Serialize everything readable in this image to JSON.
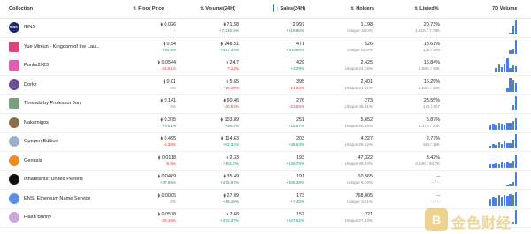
{
  "header": {
    "collection": "Collection",
    "floor": "Floor Price",
    "volume": "Volume(24H)",
    "sales": "Sales(24H)",
    "holders": "Holders",
    "listed": "Listed%",
    "volume7d": "7D Volume"
  },
  "eth_symbol": "⧫",
  "rows": [
    {
      "name": "fENS",
      "floor": "0.026",
      "floor_ch": "--",
      "floor_dir": "none",
      "vol": "71.58",
      "vol_ch": "+7,249.5%",
      "vol_dir": "pos",
      "sales": "2,997",
      "sales_ch": "+518.96%",
      "sales_dir": "pos",
      "holders": "1,198",
      "unique": "Unique 15.4%",
      "listed": "20.73%",
      "listed_sub": "1.61K / 7.78K",
      "avatar_color": "#1b2a6b",
      "avatar_label": "fENS",
      "bars": [
        0,
        0,
        0,
        0,
        0,
        0,
        0,
        0.15,
        0.6,
        1.0
      ]
    },
    {
      "name": "Yue Minjun - Kingdom of the Lau...",
      "floor": "0.54",
      "floor_ch": "+55.8%",
      "floor_dir": "pos",
      "vol": "248.51",
      "vol_ch": "+457.25%",
      "vol_dir": "pos",
      "sales": "471",
      "sales_ch": "+800.66%",
      "sales_dir": "pos",
      "holders": "526",
      "unique": "Unique 52.6%",
      "listed": "13.61%",
      "listed_sub": "136 / 999",
      "avatar_color": "#d9467a",
      "avatar_label": "",
      "bars": [
        0,
        0,
        0,
        0,
        0,
        0,
        0,
        0.2,
        0.3,
        1.0
      ]
    },
    {
      "name": "Punks2023",
      "floor": "0.0544",
      "floor_ch": "-26.51%",
      "floor_dir": "neg",
      "vol": "24.7",
      "vol_ch": "-7.12%",
      "vol_dir": "neg",
      "sales": "429",
      "sales_ch": "+2.29%",
      "sales_dir": "pos",
      "holders": "2,425",
      "unique": "Unique 24.25%",
      "listed": "16.84%",
      "listed_sub": "1.68K / 10K",
      "avatar_color": "#e05fb0",
      "avatar_label": "",
      "bars": [
        0,
        0,
        0.3,
        0.55,
        0.4,
        0.65,
        1.0,
        0.3,
        0.5,
        0.45
      ]
    },
    {
      "name": "Dorkz",
      "floor": "0.01",
      "floor_ch": "0%",
      "floor_dir": "none",
      "vol": "5.65",
      "vol_ch": "-16.39%",
      "vol_dir": "neg",
      "sales": "395",
      "sales_ch": "-14.63%",
      "sales_dir": "neg",
      "holders": "2,401",
      "unique": "Unique 24.01%",
      "listed": "16.29%",
      "listed_sub": "1.63K / 10K",
      "avatar_color": "#6a4c93",
      "avatar_label": "",
      "bars": [
        0,
        0,
        0,
        0,
        0,
        0,
        0.2,
        1.0,
        0.8,
        0.6
      ]
    },
    {
      "name": "Threads by Professor Jun",
      "floor": "0.141",
      "floor_ch": "0%",
      "floor_dir": "none",
      "vol": "60.46",
      "vol_ch": "-20.93%",
      "vol_dir": "neg",
      "sales": "276",
      "sales_ch": "-23.55%",
      "sales_dir": "neg",
      "holders": "273",
      "unique": "Unique 45.01%",
      "listed": "23.55%",
      "listed_sub": "143 / 607",
      "avatar_color": "#7a9e7e",
      "avatar_label": "",
      "bars": [
        0,
        0,
        0,
        0,
        0,
        0,
        0,
        0,
        0.35,
        1.0
      ]
    },
    {
      "name": "Nakamigos",
      "floor": "0.375",
      "floor_ch": "+5.61%",
      "floor_dir": "pos",
      "vol": "103.89",
      "vol_ch": "+36.6%",
      "vol_dir": "pos",
      "sales": "251",
      "sales_ch": "+15.67%",
      "sales_dir": "pos",
      "holders": "5,652",
      "unique": "Unique 28.26%",
      "listed": "6.87%",
      "listed_sub": "1.37K / 20K",
      "avatar_color": "#8a6d4a",
      "avatar_label": "",
      "bars": [
        0.3,
        0.4,
        0.3,
        0.5,
        0.4,
        0.35,
        0.5,
        0.45,
        0.6,
        0.8
      ]
    },
    {
      "name": "Opepen Edition",
      "floor": "0.495",
      "floor_ch": "-6.38%",
      "floor_dir": "neg",
      "vol": "114.63",
      "vol_ch": "+62.34%",
      "vol_dir": "pos",
      "sales": "203",
      "sales_ch": "+48.53%",
      "sales_dir": "pos",
      "holders": "4,227",
      "unique": "Unique 26.42%",
      "listed": "2.77%",
      "listed_sub": "443 / 16K",
      "avatar_color": "#9bb0c9",
      "avatar_label": "",
      "bars": [
        0.2,
        0.3,
        0.25,
        0.45,
        0.3,
        0.5,
        0.35,
        0.4,
        0.6,
        1.0
      ]
    },
    {
      "name": "Genesis",
      "floor": "0.0118",
      "floor_ch": "-5.6%",
      "floor_dir": "neg",
      "vol": "2.33",
      "vol_ch": "+101.0%",
      "vol_dir": "pos",
      "sales": "193",
      "sales_ch": "+129.76%",
      "sales_dir": "pos",
      "holders": "47,322",
      "unique": "Unique 49.94%",
      "listed": "3.42%",
      "listed_sub": "3.24K / 94.7K",
      "avatar_color": "#f08a24",
      "avatar_label": "",
      "bars": [
        0.2,
        0.25,
        0.3,
        0.25,
        0.4,
        0.3,
        0.35,
        0.3,
        0.5,
        0.9
      ]
    },
    {
      "name": "Inhabitants: United Planets",
      "floor": "0.0469",
      "floor_ch": "+47.95%",
      "floor_dir": "pos",
      "vol": "35.49",
      "vol_ch": "+275.57%",
      "vol_dir": "pos",
      "sales": "191",
      "sales_ch": "+306.38%",
      "sales_dir": "pos",
      "holders": "10,565",
      "unique": "Unique 6.36%",
      "listed": "--",
      "listed_sub": "-- / --",
      "avatar_color": "#111111",
      "avatar_label": "",
      "bars": [
        0,
        0,
        0,
        0,
        0,
        0,
        0.1,
        0.2,
        0.3,
        1.0
      ]
    },
    {
      "name": "ENS: Ethereum Name Service",
      "floor": "0.0005",
      "floor_ch": "0%",
      "floor_dir": "none",
      "vol": "27.09",
      "vol_ch": "+19.48%",
      "vol_dir": "pos",
      "sales": "173",
      "sales_ch": "+7.45%",
      "sales_dir": "pos",
      "holders": "768,005",
      "unique": "Unique 24.1%",
      "listed": "--",
      "listed_sub": "-- / --",
      "avatar_color": "#5a8ee8",
      "avatar_label": "",
      "bars": [
        0.5,
        0.6,
        0.55,
        0.7,
        0.6,
        0.75,
        0.65,
        0.8,
        0.7,
        0.9
      ]
    },
    {
      "name": "Flash Bunny",
      "floor": "0.0578",
      "floor_ch": "-39.16%",
      "floor_dir": "neg",
      "vol": "7.68",
      "vol_ch": "+272.27%",
      "vol_dir": "pos",
      "sales": "157",
      "sales_ch": "+647.62%",
      "sales_dir": "pos",
      "holders": "221",
      "unique": "Unique 27.63%",
      "listed": "",
      "listed_sub": "",
      "avatar_color": "#c9a7d8",
      "avatar_label": "",
      "bars": [
        0,
        0,
        0,
        0,
        0,
        0,
        0,
        0,
        0.2,
        1.0
      ]
    }
  ],
  "watermark": {
    "logo_char": "B",
    "text": "金色财经"
  }
}
